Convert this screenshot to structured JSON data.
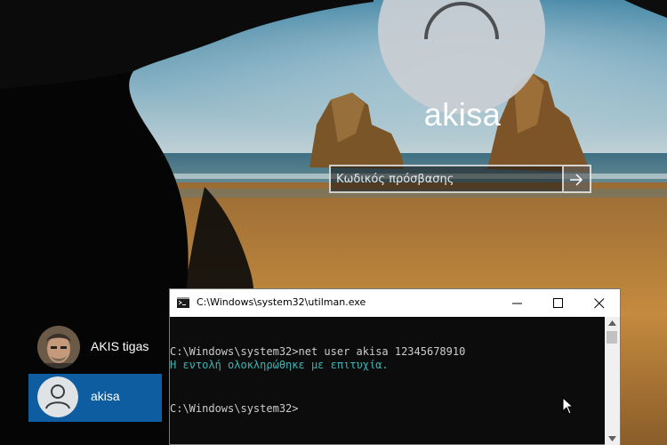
{
  "login": {
    "username": "akisa",
    "password_placeholder": "Κωδικός πρόσβασης"
  },
  "users": [
    {
      "name": "AKIS tigas",
      "selected": false
    },
    {
      "name": "akisa",
      "selected": true
    }
  ],
  "console": {
    "title": "C:\\Windows\\system32\\utilman.exe",
    "lines": {
      "cmd": "C:\\Windows\\system32>net user akisa 12345678910",
      "result": "Η εντολή ολοκληρώθηκε με επιτυχία.",
      "prompt": "C:\\Windows\\system32>"
    }
  },
  "icons": {
    "avatar": "user-silhouette-icon",
    "submit": "arrow-right-icon",
    "console": "cmd-icon",
    "minimize": "minimize-icon",
    "maximize": "maximize-icon",
    "close": "close-icon"
  },
  "colors": {
    "selected_user": "#0e5da0",
    "console_bg": "#0c0c0c",
    "success_text": "#3ab5b5",
    "console_text": "#cccccc"
  }
}
